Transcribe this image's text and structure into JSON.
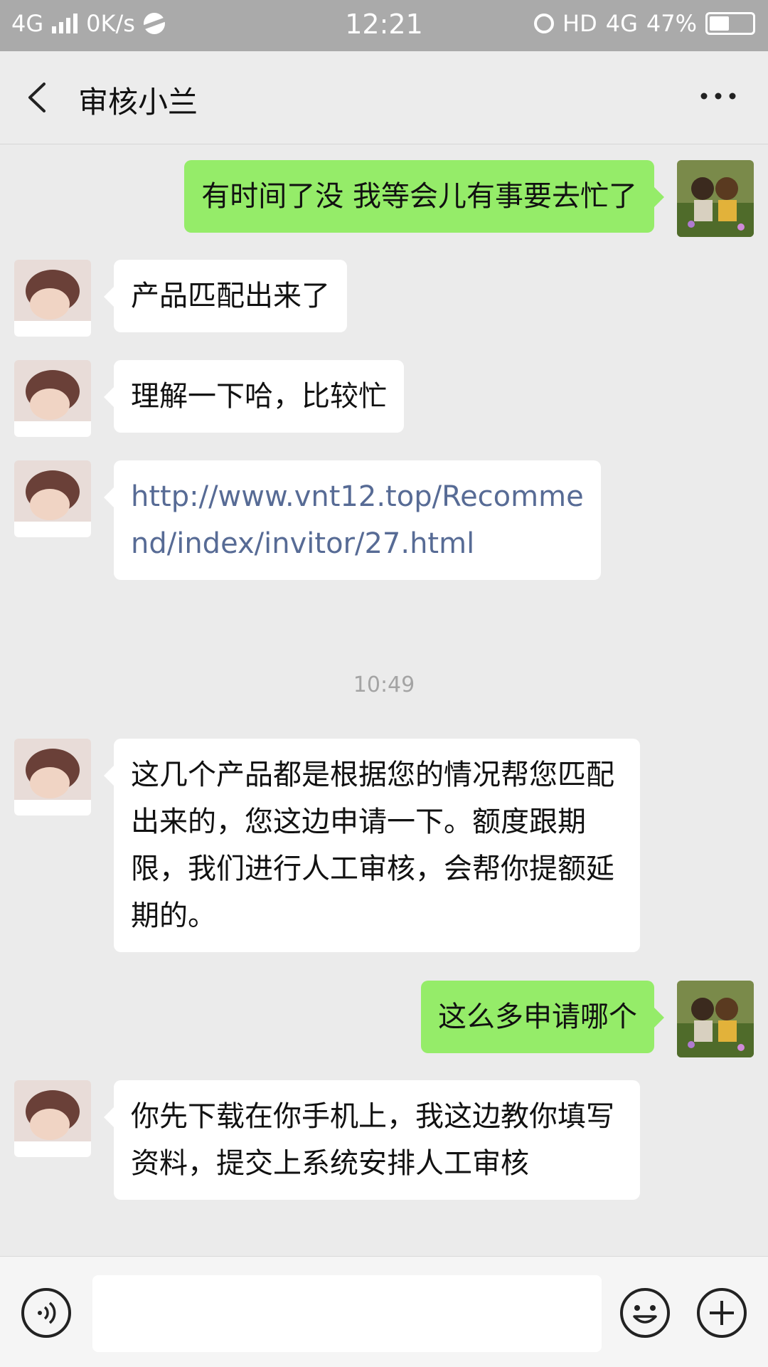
{
  "status_bar": {
    "network": "4G",
    "speed": "0K/s",
    "time": "12:21",
    "hd": "HD",
    "network2": "4G",
    "battery": "47%",
    "battery_level": 0.47
  },
  "header": {
    "title": "审核小兰",
    "back_icon": "chevron-left-icon",
    "more_icon": "more-dots-icon"
  },
  "messages": [
    {
      "side": "right",
      "text": "有时间了没 我等会儿有事要去忙了"
    },
    {
      "side": "left",
      "text": "产品匹配出来了"
    },
    {
      "side": "left",
      "text": "理解一下哈，比较忙"
    },
    {
      "side": "left",
      "text": "http://www.vnt12.top/Recommend/index/invitor/27.html",
      "type": "link"
    },
    {
      "timestamp": "10:49"
    },
    {
      "side": "left",
      "text": "这几个产品都是根据您的情况帮您匹配出来的，您这边申请一下。额度跟期限，我们进行人工审核，会帮你提额延期的。"
    },
    {
      "side": "right",
      "text": "这么多申请哪个"
    },
    {
      "side": "left",
      "text": "你先下载在你手机上，我这边教你填写资料，提交上系统安排人工审核"
    }
  ],
  "input_bar": {
    "voice_icon": "voice-icon",
    "emoji_icon": "emoji-icon",
    "plus_icon": "plus-icon",
    "value": ""
  },
  "colors": {
    "status_bar_bg": "#aaaaaa",
    "chat_bg": "#ebebeb",
    "sent_bubble": "#95ec69",
    "received_bubble": "#ffffff",
    "link": "#576b95"
  }
}
